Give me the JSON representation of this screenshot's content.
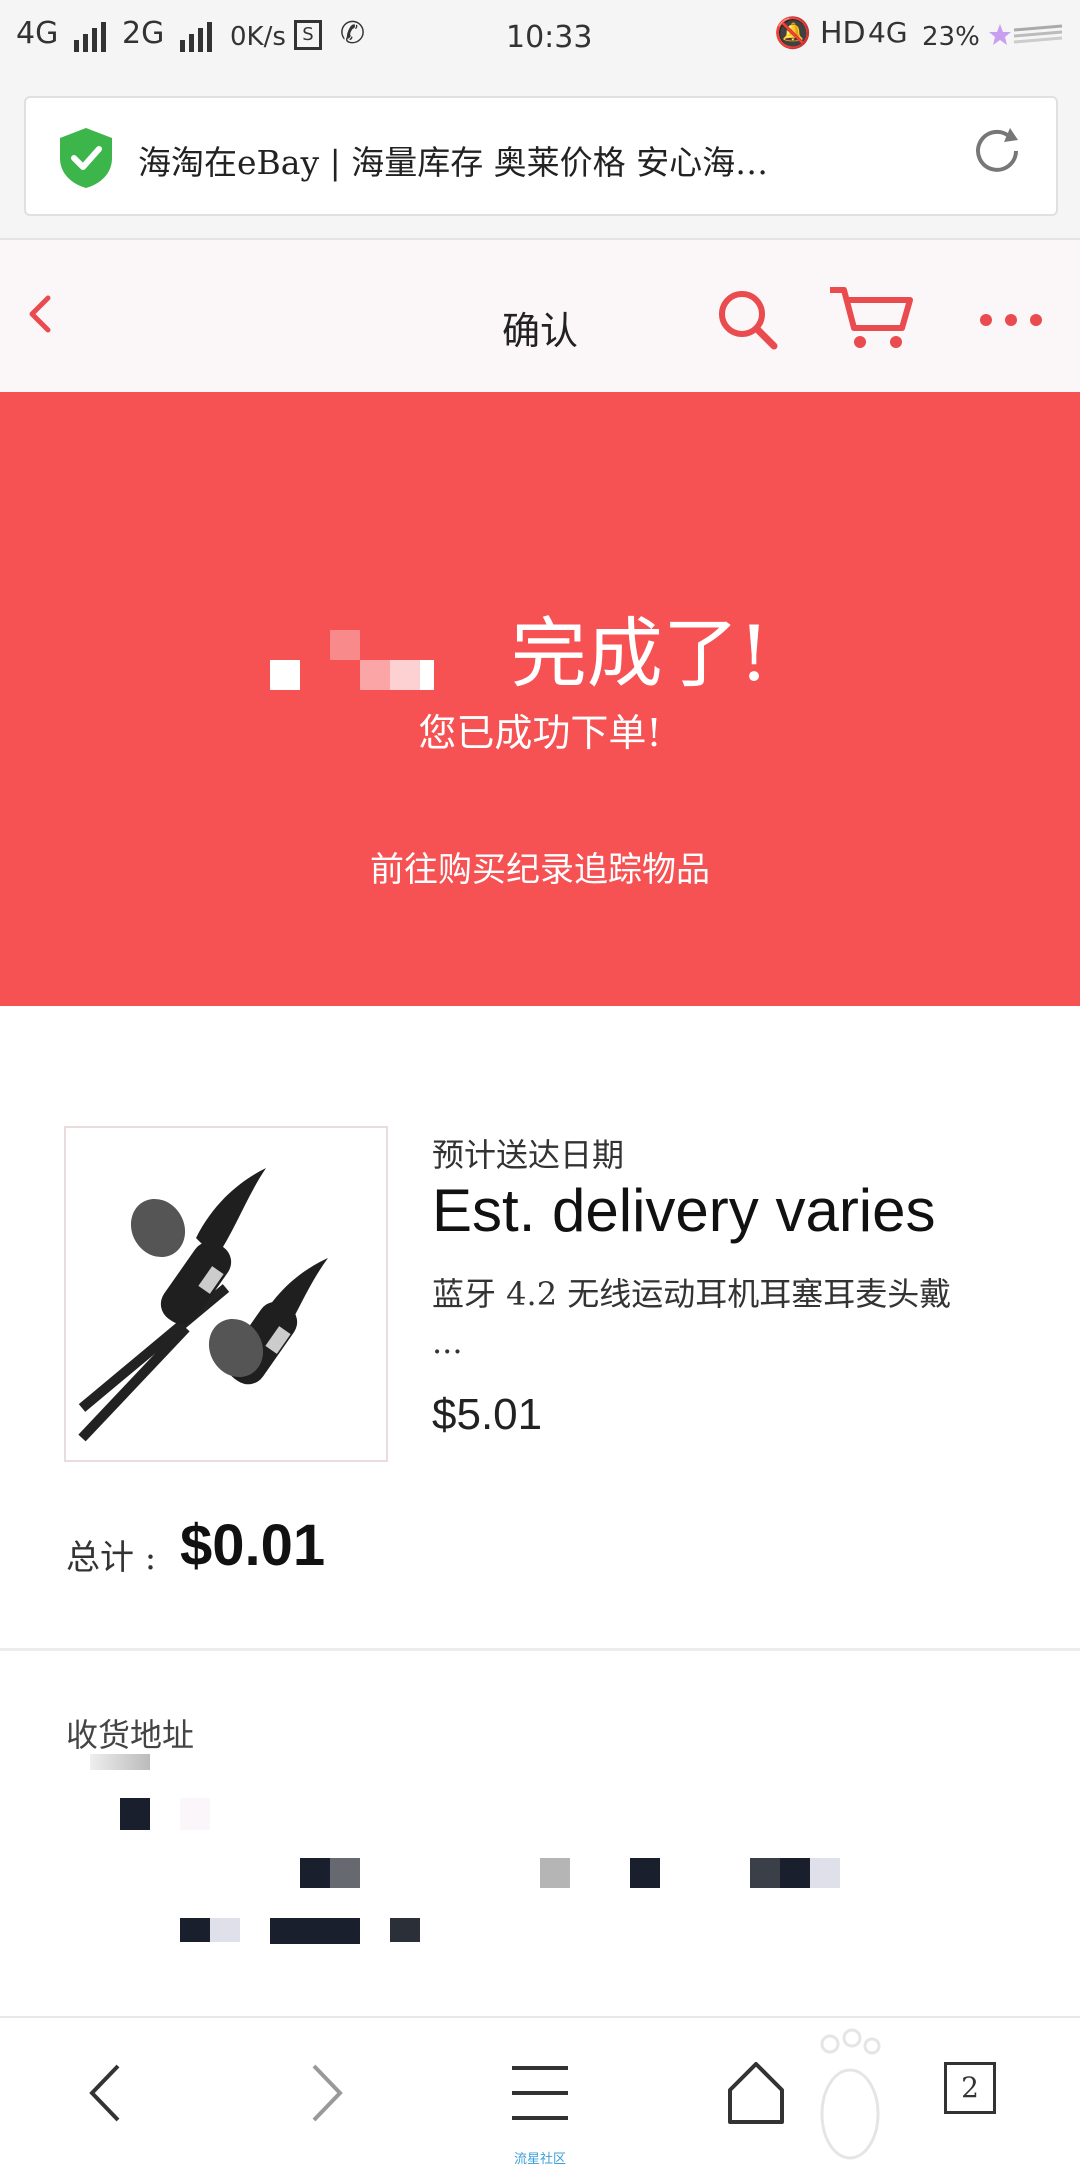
{
  "status_bar": {
    "network1": "4G",
    "network2": "2G",
    "speed": "0K/s",
    "time": "10:33",
    "hd": "HD",
    "network3": "4G",
    "battery": "23%"
  },
  "browser": {
    "url_title": "海淘在eBay | 海量库存 奥莱价格 安心海…"
  },
  "header": {
    "title": "确认"
  },
  "banner": {
    "title": "完成了!",
    "subtitle": "您已成功下单!",
    "link": "前往购买纪录追踪物品",
    "color": "#f65153"
  },
  "order": {
    "delivery_label": "预计送达日期",
    "delivery_value": "Est. delivery varies",
    "item_name": "蓝牙 4.2 无线运动耳机耳塞耳麦头戴",
    "item_name_more": "...",
    "item_price": "$5.01",
    "total_label": "总计 :",
    "total_value": "$0.01"
  },
  "address": {
    "label": "收货地址"
  },
  "bottom_nav": {
    "tab_count": "2",
    "watermark": "流星社区"
  }
}
